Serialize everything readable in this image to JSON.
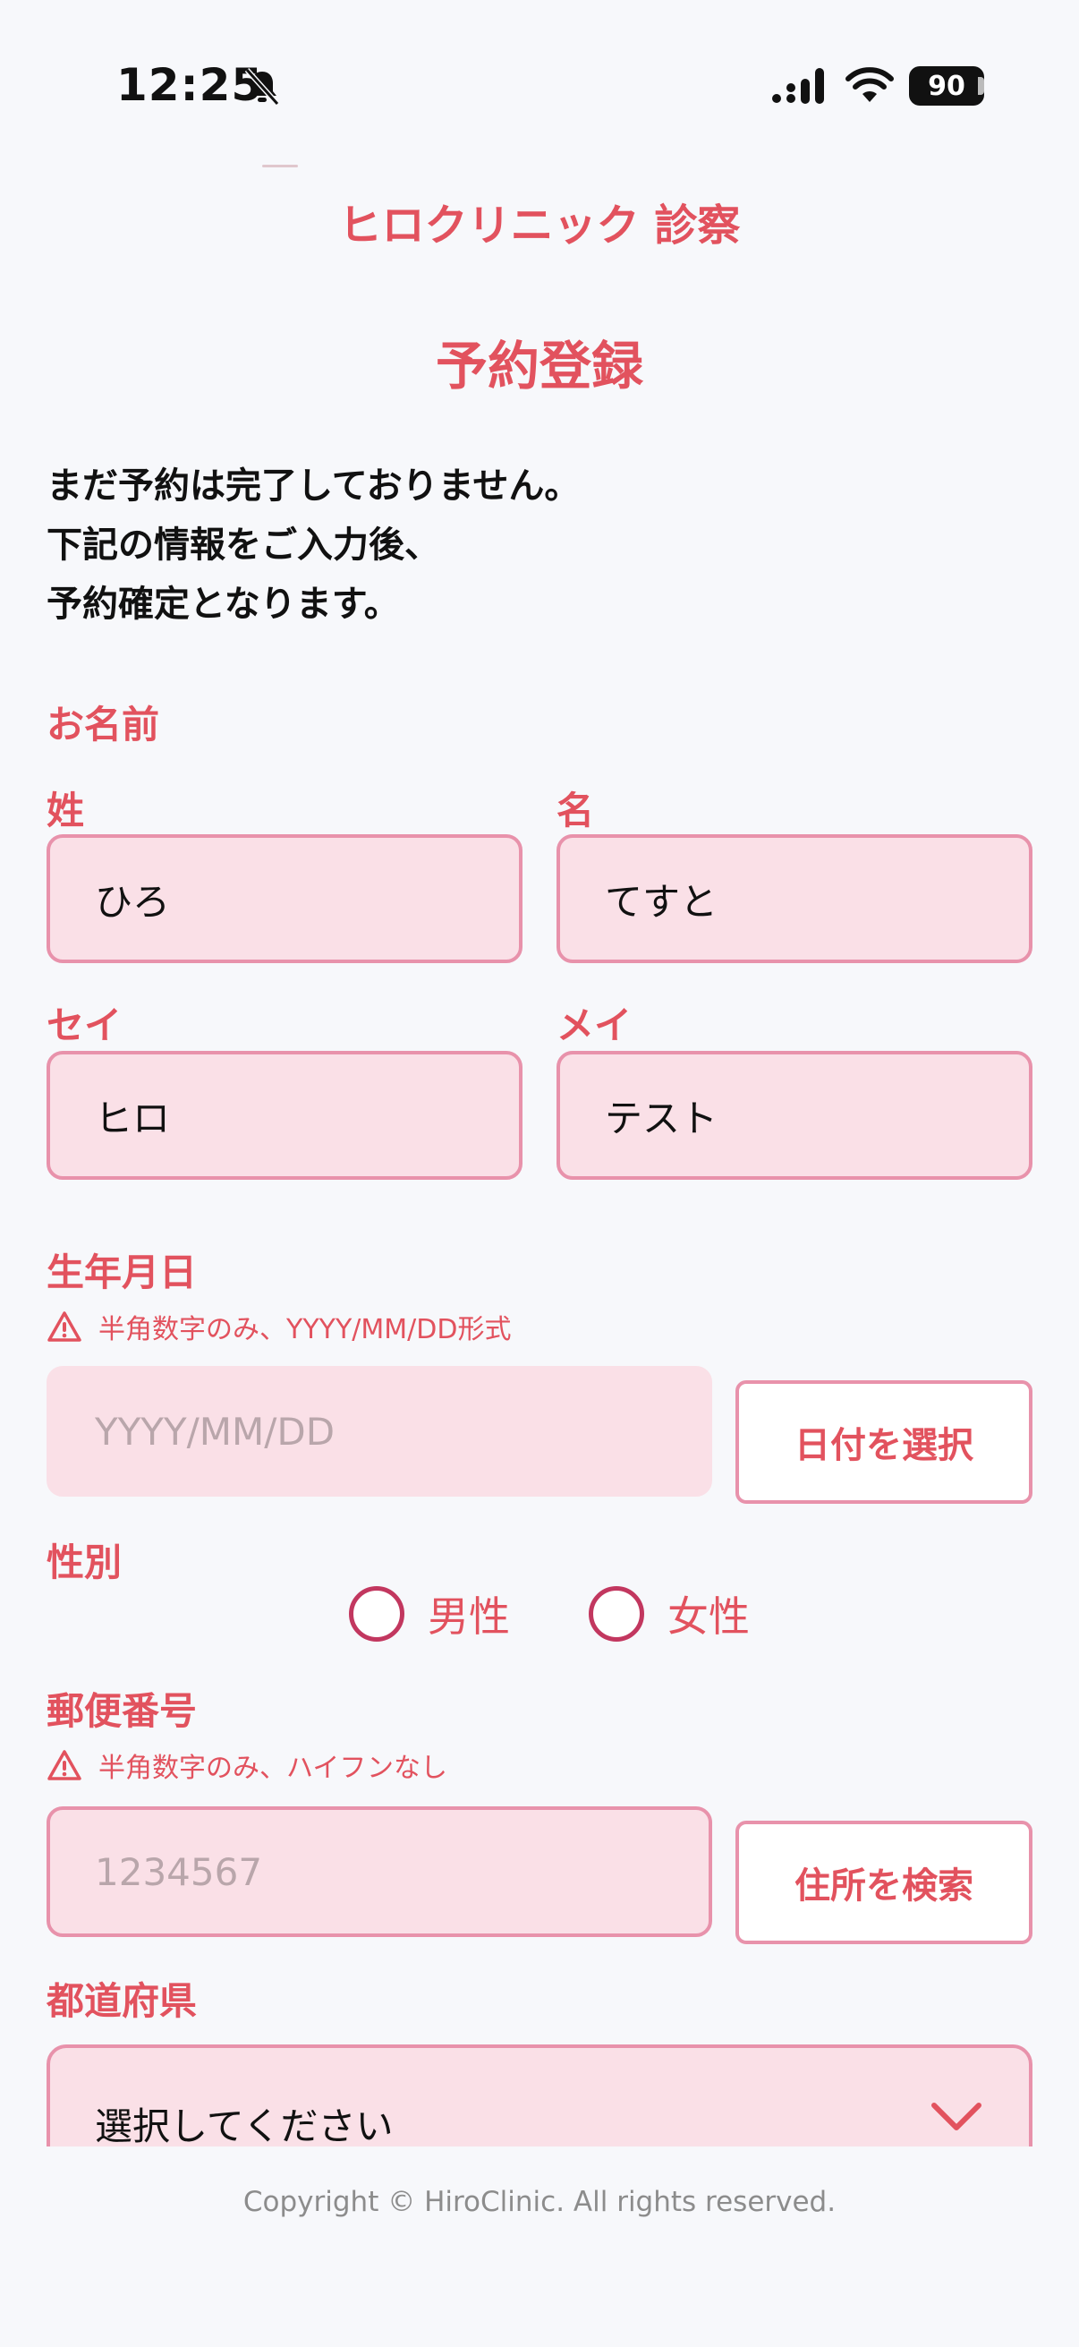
{
  "status_bar": {
    "time": "12:25",
    "battery": "90"
  },
  "header": {
    "clinic_name": "ヒロクリニック 診察",
    "page_title": "予約登録"
  },
  "intro": {
    "lines": [
      "まだ予約は完了しておりません。",
      "下記の情報をご入力後、",
      "予約確定となります。"
    ]
  },
  "name_section": {
    "label": "お名前",
    "last_name_label": "姓",
    "last_name_value": "ひろ",
    "first_name_label": "名",
    "first_name_value": "てすと",
    "last_kana_label": "セイ",
    "last_kana_value": "ヒロ",
    "first_kana_label": "メイ",
    "first_kana_value": "テスト"
  },
  "birthdate": {
    "label": "生年月日",
    "hint": "半角数字のみ、YYYY/MM/DD形式",
    "placeholder": "YYYY/MM/DD",
    "select_button": "日付を選択"
  },
  "gender": {
    "label": "性別",
    "options": [
      "男性",
      "女性"
    ]
  },
  "postal": {
    "label": "郵便番号",
    "hint": "半角数字のみ、ハイフンなし",
    "placeholder": "1234567",
    "search_button": "住所を検索"
  },
  "prefecture": {
    "label": "都道府県",
    "selected": "選択してください"
  },
  "footer": {
    "copyright": "Copyright © HiroClinic. All rights reserved."
  },
  "colors": {
    "accent": "#e2525e",
    "input_bg": "#fae0e7",
    "input_border": "#e892ab",
    "radio_border": "#c2375f",
    "page_bg": "#f7f8fb"
  }
}
